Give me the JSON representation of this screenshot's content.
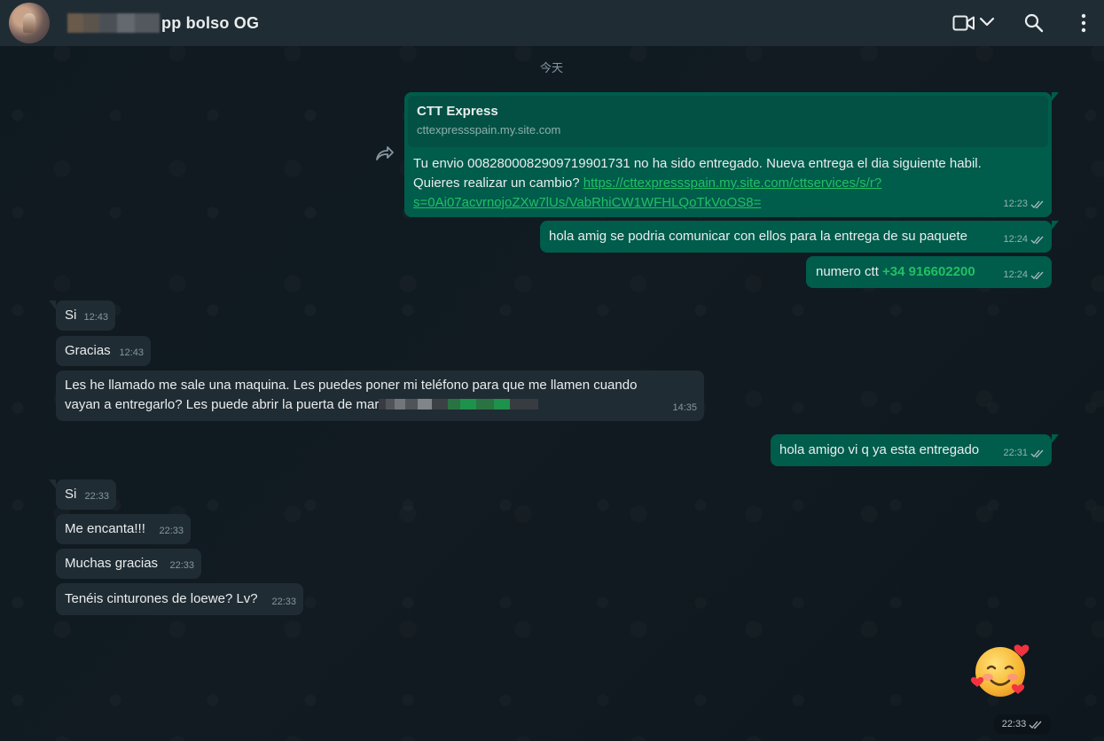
{
  "header": {
    "title": "pp bolso OG",
    "icons": [
      "avatar",
      "video-call-icon",
      "chevron-down-icon",
      "search-icon",
      "menu-icon"
    ]
  },
  "date_divider": "今天",
  "messages": {
    "ctt": {
      "preview_title": "CTT Express",
      "preview_domain": "cttexpressspain.my.site.com",
      "text_line1": "Tu envio 0082800082909719901731 no ha sido entregado. Nueva entrega el dia siguiente habil.",
      "text_line2_prefix": "Quieres realizar un cambio? ",
      "link_part1": "https://cttexpressspain.my.site.com/cttservices/s/r?",
      "link_part2": "s=0Ai07acvrnojoZXw7lUs/VabRhiCW1WFHLQoTkVoOS8=",
      "time": "12:23"
    },
    "out1": {
      "text": "hola amig se podria comunicar con ellos para la entrega de su paquete",
      "time": "12:24"
    },
    "out2": {
      "prefix": "numero ctt ",
      "phone": "+34 916602200",
      "time": "12:24"
    },
    "in1": {
      "text": "Si",
      "time": "12:43"
    },
    "in2": {
      "text": "Gracias",
      "time": "12:43"
    },
    "in3": {
      "line1": "Les he llamado me sale una maquina. Les puedes poner mi teléfono para que me llamen cuando",
      "line2": "vayan a entregarlo? Les puede abrir la puerta de mar",
      "time": "14:35"
    },
    "out3": {
      "text": "hola amigo vi q ya esta entregado",
      "time": "22:31"
    },
    "in4": {
      "text": "Si",
      "time": "22:33"
    },
    "in5": {
      "text": "Me encanta!!!",
      "time": "22:33"
    },
    "in6": {
      "text": "Muchas gracias",
      "time": "22:33"
    },
    "in7": {
      "text": "Tenéis cinturones de loewe? Lv?",
      "time": "22:33"
    },
    "emoji": {
      "glyph": "smiling-face-with-hearts",
      "time": "22:33"
    }
  },
  "colors": {
    "outgoing_bubble": "#005c4b",
    "incoming_bubble": "#202c33",
    "header": "#202c33",
    "link": "#21c063"
  }
}
